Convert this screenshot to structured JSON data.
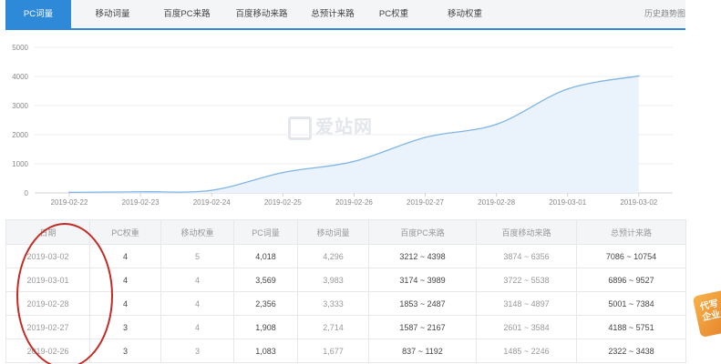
{
  "tabs": [
    {
      "label": "PC词量",
      "active": true
    },
    {
      "label": "移动词量",
      "active": false
    },
    {
      "label": "百度PC来路",
      "active": false
    },
    {
      "label": "百度移动来路",
      "active": false
    },
    {
      "label": "总预计来路",
      "active": false
    },
    {
      "label": "PC权重",
      "active": false
    },
    {
      "label": "移动权重",
      "active": false
    }
  ],
  "history_link": "历史趋势图",
  "watermark": "爱站网",
  "colors": {
    "accent": "#2e89d8",
    "line": "#7fb5e6",
    "area": "#eaf3fc",
    "annotation": "#c32a24"
  },
  "chart_data": {
    "type": "area",
    "x": [
      "2019-02-22",
      "2019-02-23",
      "2019-02-24",
      "2019-02-25",
      "2019-02-26",
      "2019-02-27",
      "2019-02-28",
      "2019-03-01",
      "2019-03-02"
    ],
    "series": [
      {
        "values": [
          20,
          40,
          90,
          700,
          1083,
          1908,
          2356,
          3569,
          4018
        ]
      }
    ],
    "yticks": [
      "0",
      "1000",
      "2000",
      "3000",
      "4000",
      "5000"
    ],
    "ylim": [
      0,
      5000
    ],
    "grid": true
  },
  "table": {
    "headers": [
      "日期",
      "PC权重",
      "移动权重",
      "PC词量",
      "移动词量",
      "百度PC来路",
      "百度移动来路",
      "总预计来路"
    ],
    "rows": [
      [
        "2019-03-02",
        "4",
        "5",
        "4,018",
        "4,296",
        "3212 ~ 4398",
        "3874 ~ 6356",
        "7086 ~ 10754"
      ],
      [
        "2019-03-01",
        "4",
        "4",
        "3,569",
        "3,983",
        "3174 ~ 3989",
        "3722 ~ 5538",
        "6896 ~ 9527"
      ],
      [
        "2019-02-28",
        "4",
        "4",
        "2,356",
        "3,333",
        "1853 ~ 2487",
        "3148 ~ 4897",
        "5001 ~ 7384"
      ],
      [
        "2019-02-27",
        "3",
        "4",
        "1,908",
        "2,714",
        "1587 ~ 2167",
        "2601 ~ 3584",
        "4188 ~ 5751"
      ],
      [
        "2019-02-26",
        "3",
        "3",
        "1,083",
        "1,677",
        "837 ~ 1192",
        "1485 ~ 2246",
        "2322 ~ 3438"
      ]
    ]
  },
  "badge": "代写企业"
}
